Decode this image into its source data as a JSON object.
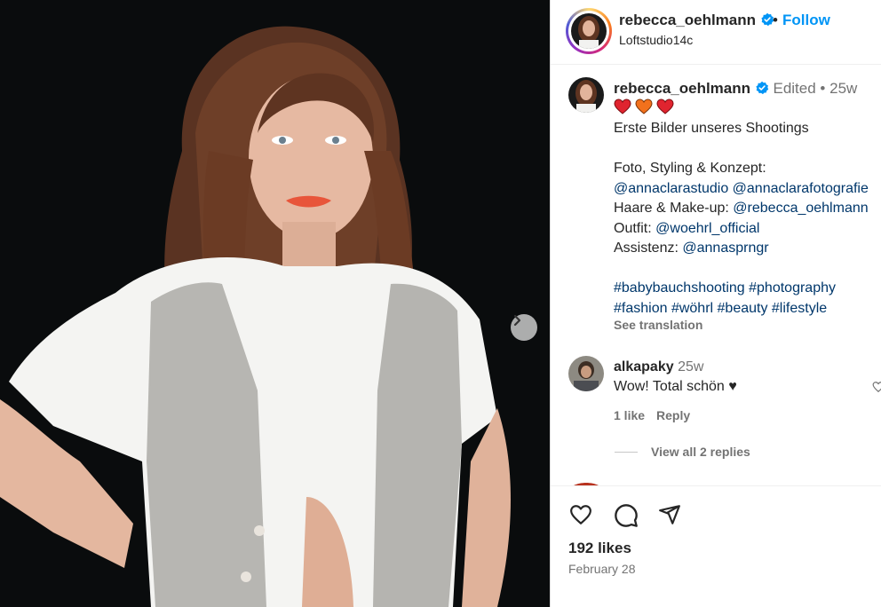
{
  "post": {
    "author": "rebecca_oehlmann",
    "follow_label": "Follow",
    "separator": "•",
    "location": "Loftstudio14c"
  },
  "caption": {
    "author": "rebecca_oehlmann",
    "edited": "Edited",
    "age": "25w",
    "emojis": [
      "heart-red",
      "heart-orange",
      "heart-red"
    ],
    "title": "Erste Bilder unseres Shootings",
    "credits_heading": "Foto, Styling & Konzept:",
    "credits_links": "@annaclarastudio @annaclarafotografie",
    "hair_label": "Haare & Make-up:",
    "hair_link": "@rebecca_oehlmann",
    "outfit_label": "Outfit:",
    "outfit_link": "@woehrl_official",
    "assist_label": "Assistenz:",
    "assist_link": "@annasprngr",
    "hashtags_line1": "#babybauchshooting #photography",
    "hashtags_line2": "#fashion #wöhrl #beauty #lifestyle",
    "see_translation": "See translation"
  },
  "comments": [
    {
      "user": "alkapaky",
      "age": "25w",
      "text": "Wow! Total schön ♥",
      "likes": "1 like",
      "reply_label": "Reply",
      "view_replies": "View all 2 replies"
    }
  ],
  "footer": {
    "likes": "192 likes",
    "date": "February 28"
  },
  "colors": {
    "accent": "#0095f6",
    "link": "#00376b",
    "muted": "#737373",
    "text": "#262626"
  }
}
